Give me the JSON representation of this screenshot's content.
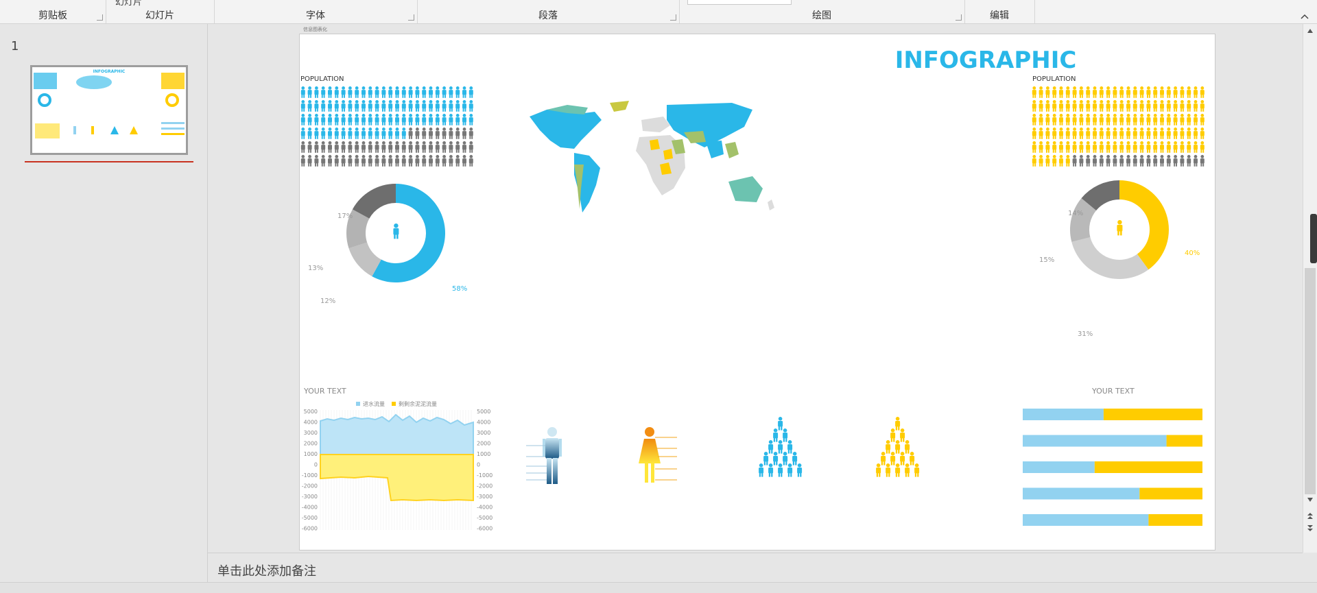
{
  "ribbon": {
    "groups": [
      {
        "label": "剪贴板"
      },
      {
        "label": "幻灯片"
      },
      {
        "label": "字体"
      },
      {
        "label": "段落"
      },
      {
        "label": "绘图"
      },
      {
        "label": "编辑"
      }
    ],
    "partial_top": {
      "slide_btn": "幻灯片"
    }
  },
  "thumbnail": {
    "number": "1"
  },
  "slide": {
    "small_title": "信息图表化",
    "title": "INFOGRAPHIC",
    "population_left": "POPULATION",
    "population_right": "POPULATION",
    "donut_left": {
      "labels": [
        "17%",
        "13%",
        "12%",
        "58%"
      ],
      "values": [
        17,
        13,
        12,
        58
      ]
    },
    "donut_right": {
      "labels": [
        "14%",
        "15%",
        "31%",
        "40%"
      ],
      "values": [
        14,
        15,
        31,
        40
      ]
    },
    "your_text_left": "YOUR TEXT",
    "your_text_right": "YOUR TEXT",
    "area_chart": {
      "legend": [
        "进水流量",
        "剩剩余泥泥流量"
      ],
      "y_ticks": [
        "5000",
        "4000",
        "3000",
        "2000",
        "1000",
        "0",
        "-1000",
        "-2000",
        "-3000",
        "-4000",
        "-5000",
        "-6000"
      ]
    },
    "bars": [
      {
        "blue": 0.45,
        "yellow": 0.55
      },
      {
        "blue": 0.8,
        "yellow": 0.2
      },
      {
        "blue": 0.4,
        "yellow": 0.6
      },
      {
        "blue": 0.65,
        "yellow": 0.35
      },
      {
        "blue": 0.7,
        "yellow": 0.3
      }
    ],
    "colors": {
      "blue": "#2ab7e8",
      "yellow": "#ffcc00",
      "gray": "#777777",
      "lightblue": "#92d2f0",
      "lightgray": "#c4c4c4"
    }
  },
  "notes": {
    "placeholder": "单击此处添加备注"
  }
}
